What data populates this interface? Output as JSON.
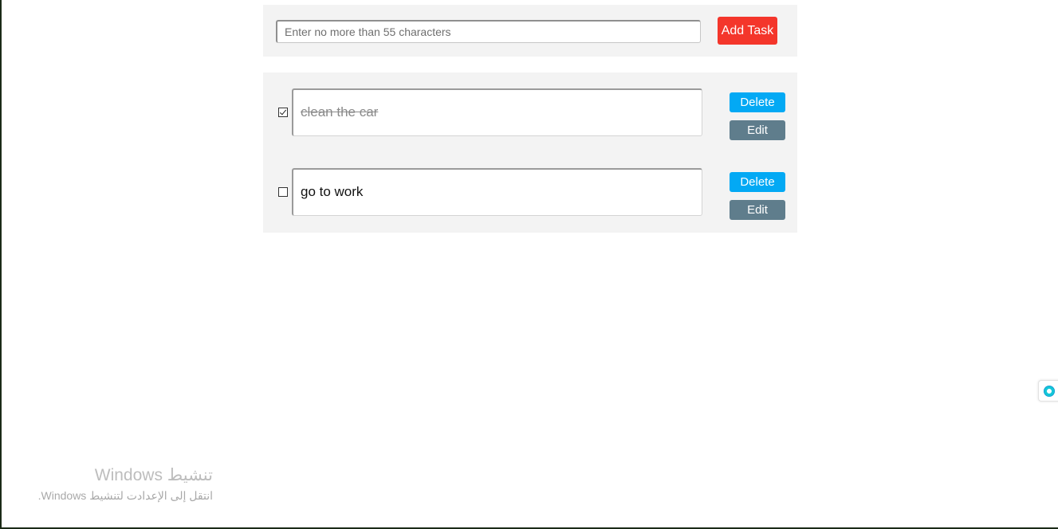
{
  "add_form": {
    "input_value": "",
    "input_placeholder": "Enter no more than 55 characters",
    "add_button_label": "Add Task",
    "add_button_color": "#f4362b"
  },
  "tasks": [
    {
      "text": "clean the car",
      "completed": true,
      "delete_label": "Delete",
      "edit_label": "Edit"
    },
    {
      "text": "go to work",
      "completed": false,
      "delete_label": "Delete",
      "edit_label": "Edit"
    }
  ],
  "colors": {
    "delete_button": "#03a9f4",
    "edit_button": "#5f7d8c",
    "panel_background": "#f3f3f3"
  },
  "os_watermark": {
    "title": "تنشيط Windows",
    "subtitle": "انتقل إلى الإعدادت لتنشيط Windows."
  },
  "side_widget": {
    "icon": "assistant-orb-icon"
  }
}
